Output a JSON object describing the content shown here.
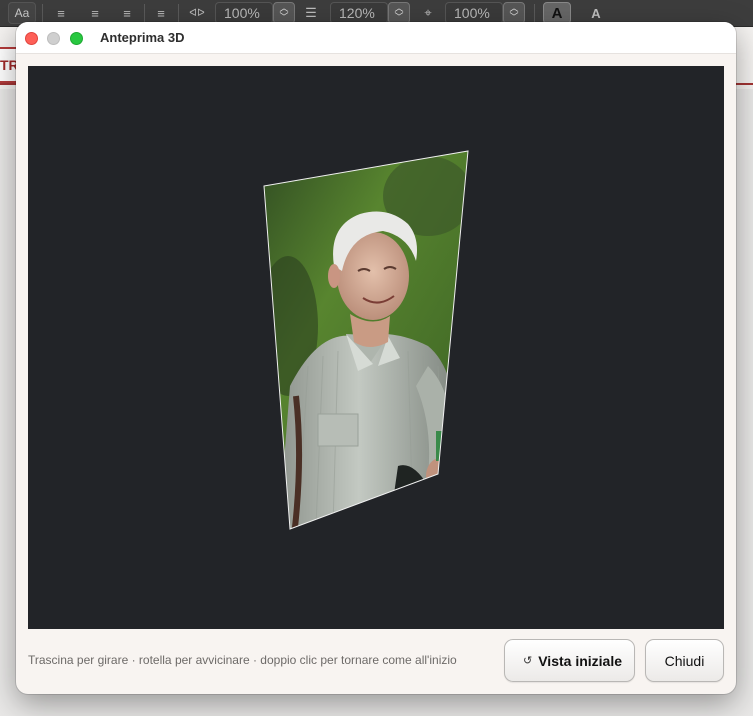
{
  "toolbar": {
    "font_button": "Aa",
    "tracking_value": "100%",
    "line_spacing_value": "120%",
    "scale_value": "100%",
    "text_color_button": "A",
    "text_outline_button": "A"
  },
  "document": {
    "frame_text": "TR"
  },
  "dialog": {
    "title": "Anteprima 3D",
    "hint": "Trascina per girare · rotella per avvicinare · doppio clic per tornare come all'inizio",
    "reset_button": "Vista iniziale",
    "close_button": "Chiudi"
  },
  "colors": {
    "viewport_bg": "#222428",
    "dialog_bg": "#f8f4f1",
    "close_light": "#fe5f57",
    "max_light": "#28c840",
    "accent_red": "#a23434"
  }
}
